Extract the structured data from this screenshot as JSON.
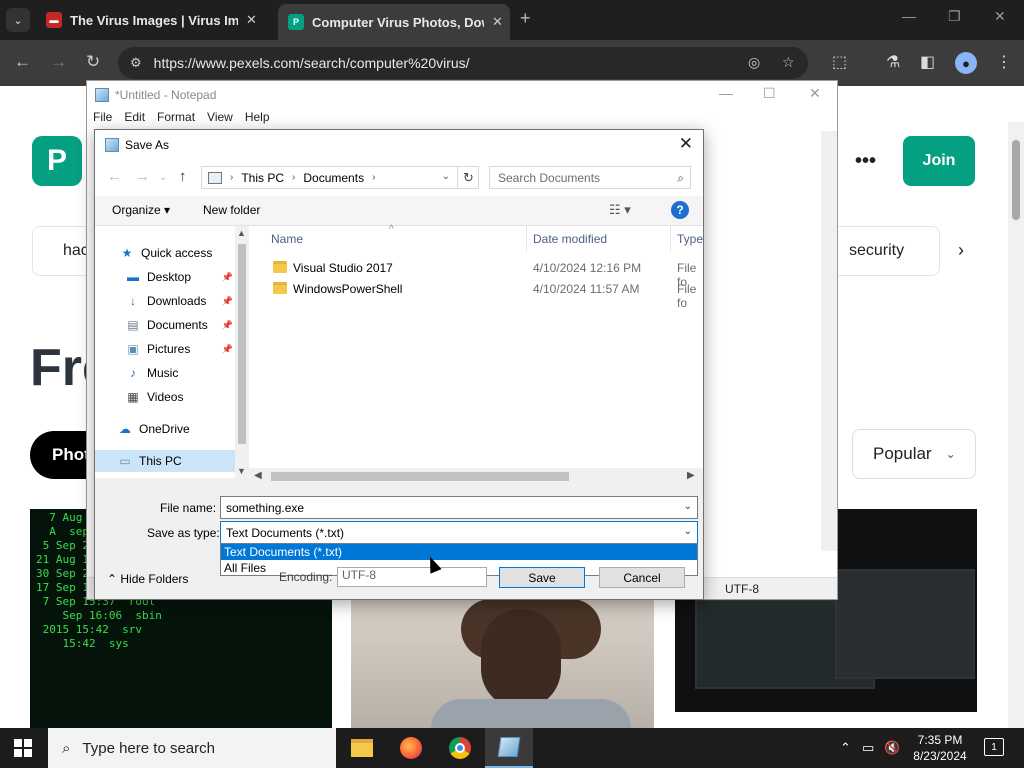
{
  "browser": {
    "tabs": [
      {
        "title": "The Virus Images | Virus Images",
        "favicon": "unsplash-favicon"
      },
      {
        "title": "Computer Virus Photos, Download",
        "favicon": "pexels-favicon"
      }
    ],
    "url": "https://www.pexels.com/search/computer%20virus/"
  },
  "pexels": {
    "logo_letter": "P",
    "join_label": "Join",
    "chip_left": "hac",
    "chip_security": "security",
    "big_title": "Fre",
    "photos_pill": "Phot",
    "sort_label": "Popular"
  },
  "notepad": {
    "title": "*Untitled - Notepad",
    "menu": [
      "File",
      "Edit",
      "Format",
      "View",
      "Help"
    ],
    "status_encoding": "UTF-8"
  },
  "save_dialog": {
    "title": "Save As",
    "address": {
      "root": "This PC",
      "folder": "Documents"
    },
    "search_placeholder": "Search Documents",
    "organize_label": "Organize",
    "new_folder_label": "New folder",
    "nav": {
      "quick_access": "Quick access",
      "desktop": "Desktop",
      "downloads": "Downloads",
      "documents": "Documents",
      "pictures": "Pictures",
      "music": "Music",
      "videos": "Videos",
      "onedrive": "OneDrive",
      "this_pc": "This PC"
    },
    "columns": {
      "name": "Name",
      "date": "Date modified",
      "type": "Type"
    },
    "files": [
      {
        "name": "Visual Studio 2017",
        "date": "4/10/2024 12:16 PM",
        "type": "File fo"
      },
      {
        "name": "WindowsPowerShell",
        "date": "4/10/2024 11:57 AM",
        "type": "File fo"
      }
    ],
    "file_name_label": "File name:",
    "file_name_value": "something.exe",
    "save_type_label": "Save as type:",
    "save_type_value": "Text Documents (*.txt)",
    "save_type_options": [
      "Text Documents (*.txt)",
      "All Files"
    ],
    "hide_folders_label": "Hide Folders",
    "encoding_label": "Encoding:",
    "encoding_value": "UTF-8",
    "save_label": "Save",
    "cancel_label": "Cancel"
  },
  "taskbar": {
    "search_placeholder": "Type here to search",
    "time": "7:35 PM",
    "date": "8/23/2024",
    "notification_count": "1"
  }
}
